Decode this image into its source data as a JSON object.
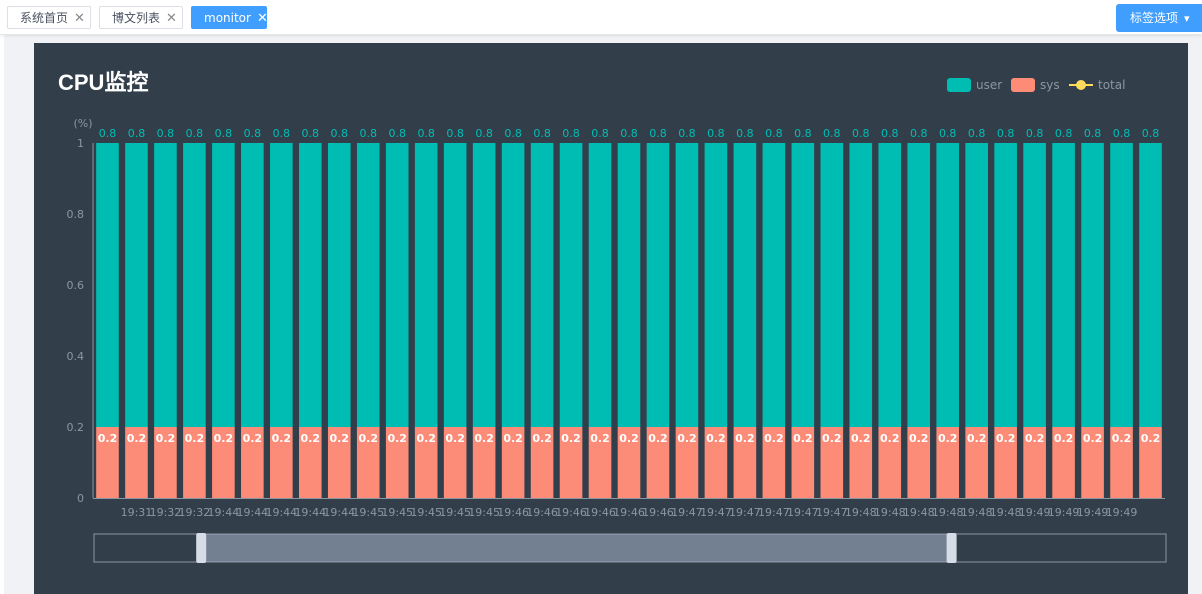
{
  "tabs": [
    {
      "label": "系统首页",
      "active": false
    },
    {
      "label": "博文列表",
      "active": false
    },
    {
      "label": "monitor",
      "active": true
    }
  ],
  "tab_options_label": "标签选项",
  "close_glyph": "✕",
  "colors": {
    "user": "#00bdb4",
    "sys": "#fc8c78",
    "total": "#ffdb5c",
    "panel_bg": "#323f4b",
    "axis": "#8c96a0"
  },
  "chart_data": {
    "type": "bar",
    "title": "CPU监控",
    "ylabel": "(%)",
    "ylim": [
      0,
      1
    ],
    "yticks": [
      0,
      0.2,
      0.4,
      0.6,
      0.8,
      1
    ],
    "stacked": true,
    "legend_position": "top-right",
    "legend": [
      "user",
      "sys",
      "total"
    ],
    "categories": [
      "19:31",
      "19:32",
      "19:32",
      "19:44",
      "19:44",
      "19:44",
      "19:44",
      "19:44",
      "19:45",
      "19:45",
      "19:45",
      "19:45",
      "19:45",
      "19:46",
      "19:46",
      "19:46",
      "19:46",
      "19:46",
      "19:46",
      "19:47",
      "19:47",
      "19:47",
      "19:47",
      "19:47",
      "19:47",
      "19:48",
      "19:48",
      "19:48",
      "19:48",
      "19:48",
      "19:48",
      "19:49",
      "19:49",
      "19:49",
      "19:49"
    ],
    "series": [
      {
        "name": "sys",
        "values": [
          0.2,
          0.2,
          0.2,
          0.2,
          0.2,
          0.2,
          0.2,
          0.2,
          0.2,
          0.2,
          0.2,
          0.2,
          0.2,
          0.2,
          0.2,
          0.2,
          0.2,
          0.2,
          0.2,
          0.2,
          0.2,
          0.2,
          0.2,
          0.2,
          0.2,
          0.2,
          0.2,
          0.2,
          0.2,
          0.2,
          0.2,
          0.2,
          0.2,
          0.2,
          0.2,
          0.2,
          0.2
        ]
      },
      {
        "name": "user",
        "values": [
          0.8,
          0.8,
          0.8,
          0.8,
          0.8,
          0.8,
          0.8,
          0.8,
          0.8,
          0.8,
          0.8,
          0.8,
          0.8,
          0.8,
          0.8,
          0.8,
          0.8,
          0.8,
          0.8,
          0.8,
          0.8,
          0.8,
          0.8,
          0.8,
          0.8,
          0.8,
          0.8,
          0.8,
          0.8,
          0.8,
          0.8,
          0.8,
          0.8,
          0.8,
          0.8,
          0.8,
          0.8
        ]
      }
    ],
    "datazoom": {
      "start": 0.1,
      "end": 0.8
    }
  }
}
